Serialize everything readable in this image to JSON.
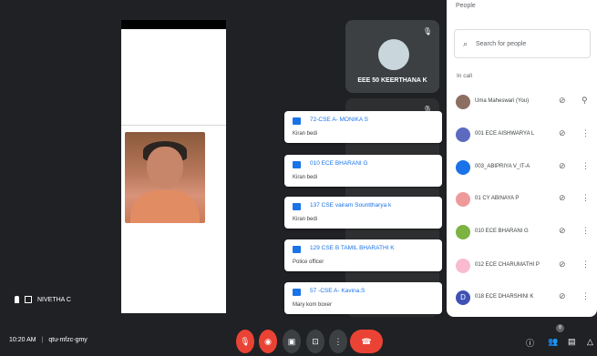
{
  "stage": {
    "tile_name": "EEE 50 KEERTHANA K",
    "self_name": "NIVETHA C"
  },
  "chat": [
    {
      "from": "72-CSE A- MONIKA S",
      "message": "Kiran bedi"
    },
    {
      "from": "010 ECE BHARANI G",
      "message": "Kiran bedi"
    },
    {
      "from": "137 CSE vairam Sounttharya k",
      "message": "Kiran bedi"
    },
    {
      "from": "129 CSE B TAMIL BHARATHI K",
      "message": "Police officer"
    },
    {
      "from": "57 -CSE A- Kavina.S",
      "message": "Mary kom boxer"
    }
  ],
  "meeting": {
    "time": "10:20 AM",
    "separator": "|",
    "code": "qtu-mfzc-gmy"
  },
  "controls": {
    "mic_icon": "mic-off-icon",
    "camera_icon": "camera-off-icon",
    "captions_icon": "captions-icon",
    "present_icon": "present-icon",
    "more_icon": "more-vert-icon",
    "hangup_icon": "phone-icon",
    "participant_count": "8"
  },
  "people_panel": {
    "title": "People",
    "search_placeholder": "Search for people",
    "section_label": "In call",
    "participants": [
      {
        "name": "Uma Maheswari (You)",
        "color": "#8d6e63"
      },
      {
        "name": "001 ECE AISHWARYA L",
        "color": "#5c6bc0"
      },
      {
        "name": "003_ABIPRIYA V_IT-A",
        "color": "#1a73e8"
      },
      {
        "name": "01 CY ABINAYA P",
        "color": "#ef9a9a"
      },
      {
        "name": "010 ECE BHARANI G",
        "color": "#7cb342"
      },
      {
        "name": "012 ECE CHARUMATHI P",
        "color": "#f8bbd0"
      },
      {
        "name": "018 ECE DHARSHINI K",
        "color": "#3f51b5",
        "letter": "D"
      }
    ]
  },
  "colors": {
    "background": "#202124",
    "accent": "#1a73e8",
    "danger": "#ea4335"
  }
}
